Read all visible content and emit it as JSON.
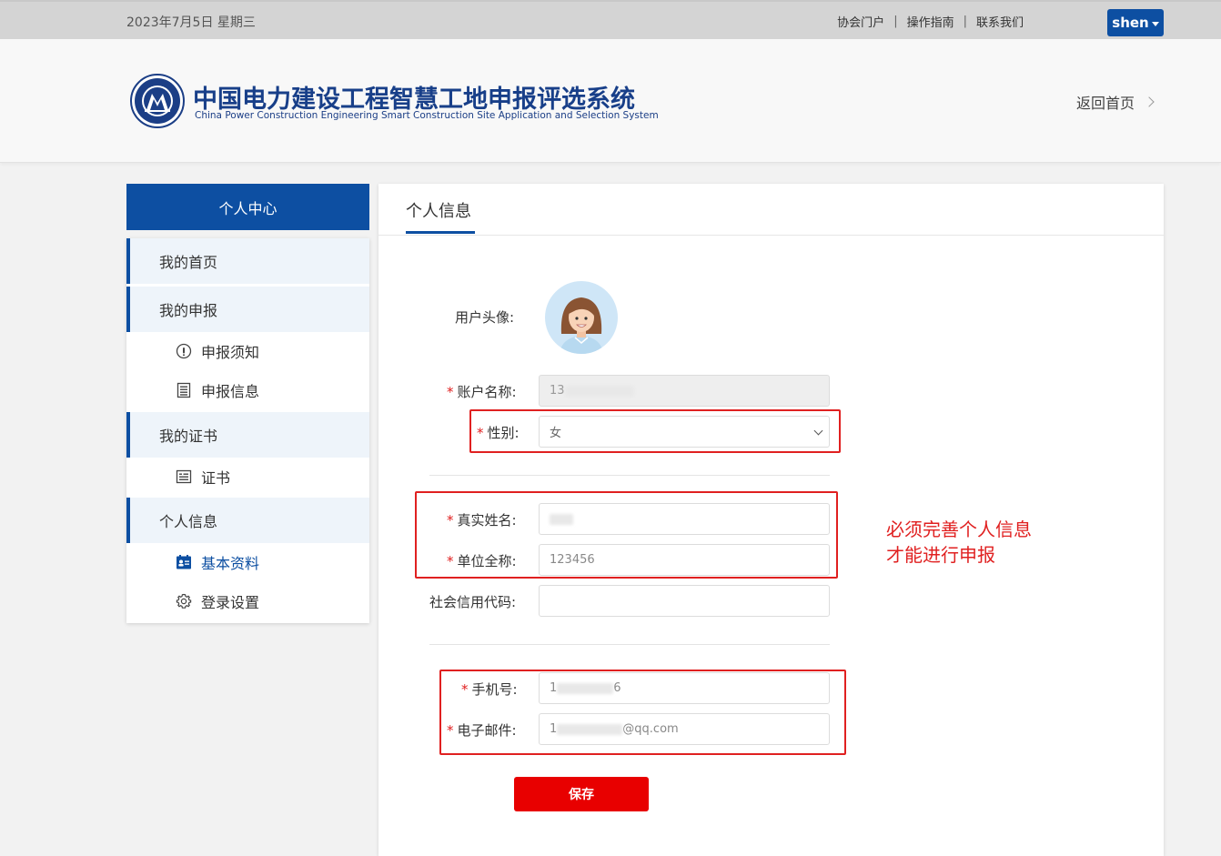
{
  "topbar": {
    "date": "2023年7月5日 星期三",
    "links": [
      "协会门户",
      "操作指南",
      "联系我们"
    ],
    "user": "shen"
  },
  "header": {
    "title": "中国电力建设工程智慧工地申报评选系统",
    "subtitle": "China Power Construction Engineering Smart Construction Site Application and Selection System",
    "back_home": "返回首页"
  },
  "sidebar": {
    "title": "个人中心",
    "items": [
      {
        "label": "我的首页",
        "type": "group"
      },
      {
        "label": "我的申报",
        "type": "group"
      },
      {
        "label": "申报须知",
        "type": "sub",
        "icon": "info-icon"
      },
      {
        "label": "申报信息",
        "type": "sub",
        "icon": "document-icon"
      },
      {
        "label": "我的证书",
        "type": "group"
      },
      {
        "label": "证书",
        "type": "sub",
        "icon": "certificate-icon"
      },
      {
        "label": "个人信息",
        "type": "group"
      },
      {
        "label": "基本资料",
        "type": "sub",
        "icon": "profile-card-icon",
        "active": true
      },
      {
        "label": "登录设置",
        "type": "sub",
        "icon": "gear-icon"
      }
    ]
  },
  "main": {
    "tab": "个人信息",
    "form": {
      "avatar_label": "用户头像:",
      "account_label": "账户名称:",
      "account_value": "13",
      "gender_label": "性别:",
      "gender_value": "女",
      "realname_label": "真实姓名:",
      "realname_value": "",
      "company_label": "单位全称:",
      "company_value": "123456",
      "credit_label": "社会信用代码:",
      "credit_value": "",
      "phone_label": "手机号:",
      "phone_value_start": "1",
      "phone_value_end": "6",
      "email_label": "电子邮件:",
      "email_value_start": "1",
      "email_value_end": "@qq.com",
      "required_mark": "*",
      "save_label": "保存"
    },
    "note_line1": "必须完善个人信息",
    "note_line2": "才能进行申报"
  },
  "colors": {
    "brand": "#0d4fa2",
    "danger": "#e02020",
    "save": "#e80000"
  }
}
